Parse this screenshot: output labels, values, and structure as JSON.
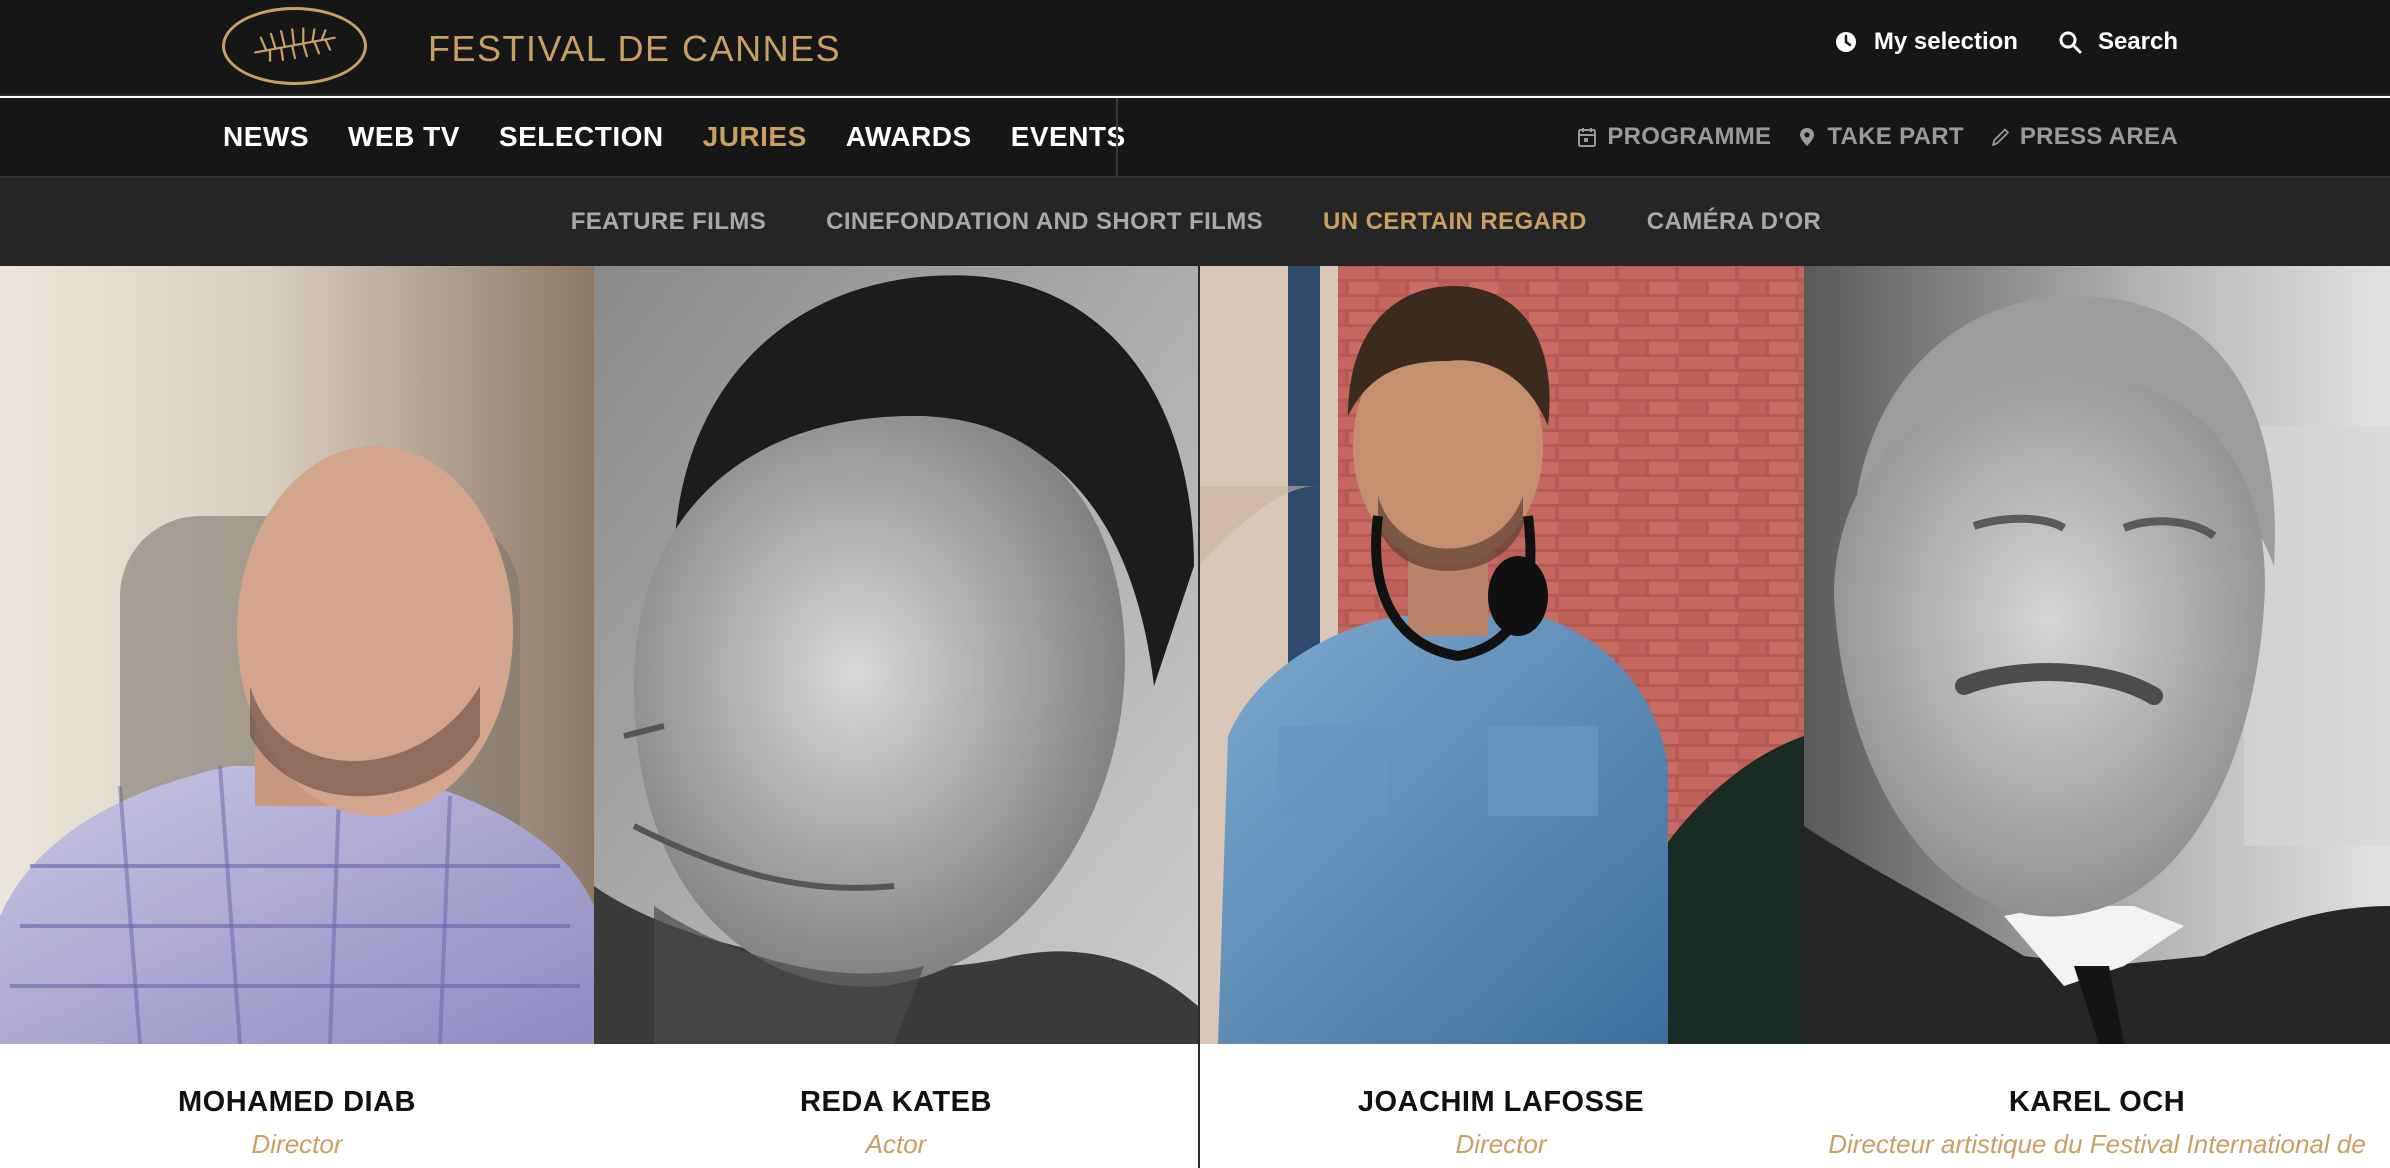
{
  "header": {
    "brand": "FESTIVAL DE CANNES",
    "actions": [
      {
        "label": "My selection",
        "icon": "clock-icon"
      },
      {
        "label": "Search",
        "icon": "search-icon"
      }
    ]
  },
  "nav": {
    "items": [
      {
        "label": "NEWS",
        "active": false
      },
      {
        "label": "WEB TV",
        "active": false
      },
      {
        "label": "SELECTION",
        "active": false
      },
      {
        "label": "JURIES",
        "active": true
      },
      {
        "label": "AWARDS",
        "active": false
      },
      {
        "label": "EVENTS",
        "active": false
      }
    ],
    "right": [
      {
        "label": "PROGRAMME",
        "icon": "calendar-icon"
      },
      {
        "label": "TAKE PART",
        "icon": "location-pin-icon"
      },
      {
        "label": "PRESS AREA",
        "icon": "pencil-icon"
      }
    ]
  },
  "subnav": {
    "items": [
      {
        "label": "FEATURE FILMS",
        "active": false
      },
      {
        "label": "CINEFONDATION AND SHORT FILMS",
        "active": false
      },
      {
        "label": "UN CERTAIN REGARD",
        "active": true
      },
      {
        "label": "CAMÉRA D'OR",
        "active": false
      }
    ]
  },
  "jury": [
    {
      "name": "MOHAMED DIAB",
      "role": "Director"
    },
    {
      "name": "REDA KATEB",
      "role": "Actor"
    },
    {
      "name": "JOACHIM LAFOSSE",
      "role": "Director"
    },
    {
      "name": "KAREL OCH",
      "role": "Directeur artistique du Festival International de"
    }
  ],
  "colors": {
    "accent": "#c8a062",
    "header_bg": "#161616",
    "subnav_bg": "#252525"
  }
}
